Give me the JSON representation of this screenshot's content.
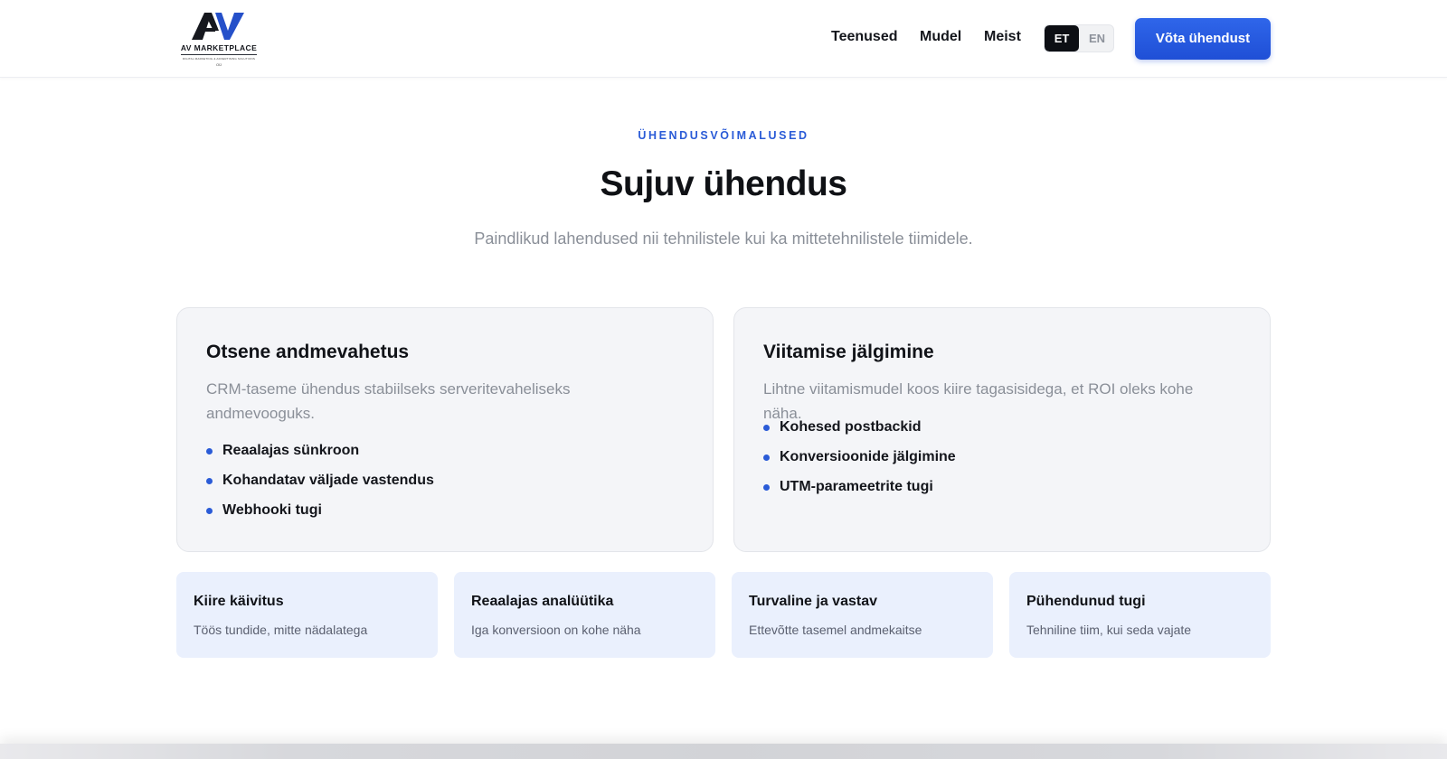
{
  "header": {
    "logo_text": "AV MARKETPLACE",
    "logo_tagline": "DIGITAL MARKETING & ADVERTISING SOLUTIONS",
    "logo_suffix": "OÜ",
    "nav": [
      "Teenused",
      "Mudel",
      "Meist"
    ],
    "lang": {
      "active": "ET",
      "inactive": "EN"
    },
    "cta_label": "Võta ühendust"
  },
  "section": {
    "eyebrow": "ÜHENDUSVÕIMALUSED",
    "title": "Sujuv ühendus",
    "subtitle": "Paindlikud lahendused nii tehnilistele kui ka mittetehnilistele tiimidele."
  },
  "cards": [
    {
      "title": "Otsene andmevahetus",
      "description": "CRM-taseme ühendus stabiilseks serveritevaheliseks andmevooguks.",
      "items": [
        "Reaalajas sünkroon",
        "Kohandatav väljade vastendus",
        "Webhooki tugi"
      ]
    },
    {
      "title": "Viitamise jälgimine",
      "description": "Lihtne viitamismudel koos kiire tagasisidega, et ROI oleks kohe näha.",
      "items": [
        "Kohesed postbackid",
        "Konversioonide jälgimine",
        "UTM-parameetrite tugi"
      ]
    }
  ],
  "features": [
    {
      "title": "Kiire käivitus",
      "description": "Töös tundide, mitte nädalatega"
    },
    {
      "title": "Reaalajas analüütika",
      "description": "Iga konversioon on kohe näha"
    },
    {
      "title": "Turvaline ja vastav",
      "description": "Ettevõtte tasemel andmekaitse"
    },
    {
      "title": "Pühendunud tugi",
      "description": "Tehniline tiim, kui seda vajate"
    }
  ],
  "colors": {
    "accent": "#2a5bd7",
    "cta": "#2f66ea",
    "card_bg": "#f4f5f8",
    "tile_bg": "#eaf0fd"
  }
}
